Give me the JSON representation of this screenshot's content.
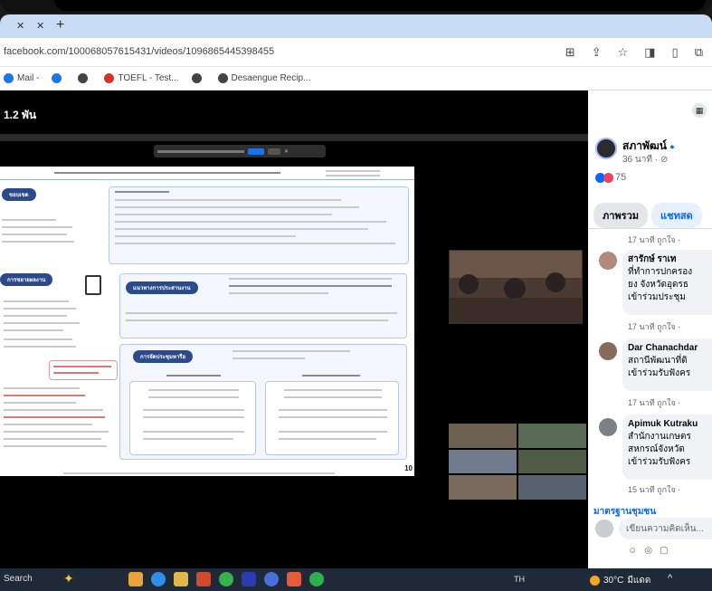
{
  "browser": {
    "tab_close": "✕",
    "tab_secondary": "✕",
    "tab_new": "+",
    "url": "facebook.com/100068057615431/videos/1096865445398455",
    "bookmarks": [
      {
        "label": "Mail - ",
        "color": "#1a73e8"
      },
      {
        "label": "",
        "color": "#1877f2"
      },
      {
        "label": "",
        "color": "#444444"
      },
      {
        "label": " TOEFL - Test...",
        "color": "#d93025"
      },
      {
        "label": "",
        "color": "#444444"
      },
      {
        "label": "Desaengue Recip...",
        "color": "#444444"
      }
    ]
  },
  "video": {
    "views": "1.2 พัน",
    "meeting_banner": {
      "text": "",
      "primary_button": "",
      "secondary_button": ""
    },
    "slide": {
      "page_number": "10",
      "pills": [
        "ขอบเขต",
        "การขยายผลงาน",
        "แนวทางการประสานงาน",
        "การจัดประชุมหารือ"
      ]
    }
  },
  "sidepanel": {
    "page_name": "สภาพัฒน์",
    "page_time": "36 นาที",
    "reaction_count": "75",
    "tabs": [
      "ภาพรวม",
      "แชทสด"
    ],
    "comments": [
      {
        "meta": "17 นาที   ถูกใจ   ·",
        "name": "",
        "lines": []
      },
      {
        "meta": "17 นาที   ถูกใจ   ·",
        "name": "สารักษ์ ราเท",
        "lines": [
          "ที่ทำการปกครอง",
          "ยง จังหวัดอุดรธ",
          "เข้าร่วมประชุม"
        ]
      },
      {
        "meta": "17 นาที   ถูกใจ   ·",
        "name": "Dar Chanachdar",
        "lines": [
          "สถานีพัฒนาที่ดิ",
          "เข้าร่วมรับฟังคร"
        ]
      },
      {
        "meta": "15 นาที   ถูกใจ   ·",
        "name": "Apimuk Kutraku",
        "lines": [
          "สำนักงานเกษตร",
          "สหกรณ์จังหวัด",
          "เข้าร่วมรับฟังคร"
        ]
      }
    ],
    "footer_title": "มาตรฐานชุมชน",
    "write_placeholder": "เขียนความคิดเห็น..."
  },
  "taskbar": {
    "search": "Search",
    "mid_text": "TH",
    "weather": "30°C",
    "weather_desc": "มีแดด",
    "right_icon": "^"
  },
  "colors": {
    "fb_blue": "#0866ff",
    "slide_navy": "#2c4a8a",
    "taskbar": "#202938"
  }
}
